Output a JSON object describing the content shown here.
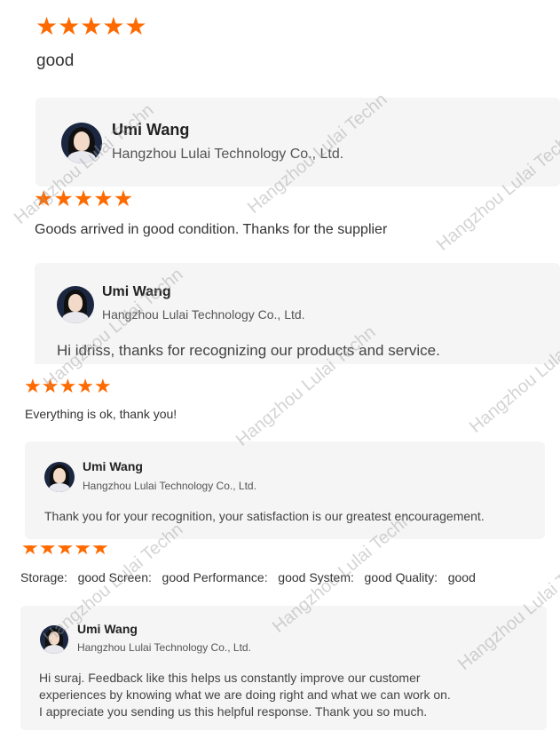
{
  "reviews": [
    {
      "rating": 5,
      "text": "good",
      "reply": {
        "name": "Umi Wang",
        "company": "Hangzhou Lulai Technology Co., Ltd.",
        "lines": []
      }
    },
    {
      "rating": 5,
      "text": "Goods arrived in good condition. Thanks for the supplier",
      "reply": {
        "name": "Umi Wang",
        "company": "Hangzhou Lulai Technology Co., Ltd.",
        "lines": [
          "Hi idriss, thanks for recognizing our products and service."
        ]
      }
    },
    {
      "rating": 5,
      "text": "Everything is ok, thank you!",
      "reply": {
        "name": "Umi Wang",
        "company": "Hangzhou Lulai Technology Co., Ltd.",
        "lines": [
          "Thank you for your recognition, your satisfaction is our greatest encouragement."
        ]
      }
    },
    {
      "rating": 5,
      "text": "Storage:   good Screen:   good Performance:   good System:   good Quality:   good",
      "reply": {
        "name": "Umi Wang",
        "company": "Hangzhou Lulai Technology Co., Ltd.",
        "lines": [
          "Hi suraj. Feedback like this helps us constantly improve our customer",
          "experiences by knowing what we are doing right and what we can work on.",
          "I appreciate you sending us this helpful response. Thank you so much."
        ]
      }
    }
  ],
  "star_glyph": "★",
  "watermark": "Hangzhou Lulai Techn",
  "colors": {
    "star": "#ff6a00",
    "reply_bg": "#f5f5f5"
  }
}
